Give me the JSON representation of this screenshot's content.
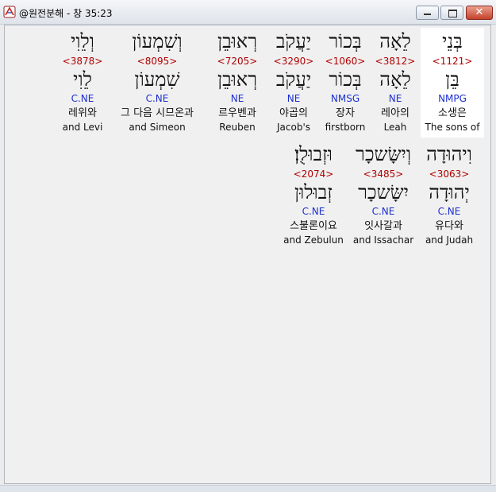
{
  "window": {
    "title": "@원전분해 - 창 35:23",
    "close_glyph": "✕"
  },
  "words": [
    {
      "hebrew": "בְּנֵי",
      "strong": "<1121>",
      "lemma": "בֵּן",
      "morph": "NMPG",
      "korean": "소생은",
      "english": "The sons of"
    },
    {
      "hebrew": "לֵאָה",
      "strong": "<3812>",
      "lemma": "לֵאָה",
      "morph": "NE",
      "korean": "레아의",
      "english": "Leah"
    },
    {
      "hebrew": "בְּכוֹר",
      "strong": "<1060>",
      "lemma": "בְּכוֹר",
      "morph": "NMSG",
      "korean": "장자",
      "english": "firstborn"
    },
    {
      "hebrew": "יַעֲקֹב",
      "strong": "<3290>",
      "lemma": "יַעֲקֹב",
      "morph": "NE",
      "korean": "야곱의",
      "english": "Jacob's"
    },
    {
      "hebrew": "רְאוּבֵן",
      "strong": "<7205>",
      "lemma": "רְאוּבֵן",
      "morph": "NE",
      "korean": "르우벤과",
      "english": "Reuben"
    },
    {
      "hebrew": "וְשִׁמְעוֹן",
      "strong": "<8095>",
      "lemma": "שִׁמְעוֹן",
      "morph": "C.NE",
      "korean": "그 다음 시므온과",
      "english": "and Simeon"
    },
    {
      "hebrew": "וְלֵוִי",
      "strong": "<3878>",
      "lemma": "לֵוִי",
      "morph": "C.NE",
      "korean": "레위와",
      "english": "and Levi"
    },
    {
      "hebrew": "וִיהוּדָה",
      "strong": "<3063>",
      "lemma": "יְהוּדָה",
      "morph": "C.NE",
      "korean": "유다와",
      "english": "and Judah"
    },
    {
      "hebrew": "וְיִשָּׂשכָר",
      "strong": "<3485>",
      "lemma": "יִשָּׂשכָר",
      "morph": "C.NE",
      "korean": "잇사갈과",
      "english": "and Issachar"
    },
    {
      "hebrew": "וּזְבוּלֻן׃",
      "strong": "<2074>",
      "lemma": "זְבוּלוּן",
      "morph": "C.NE",
      "korean": "스불론이요",
      "english": "and Zebulun"
    }
  ]
}
